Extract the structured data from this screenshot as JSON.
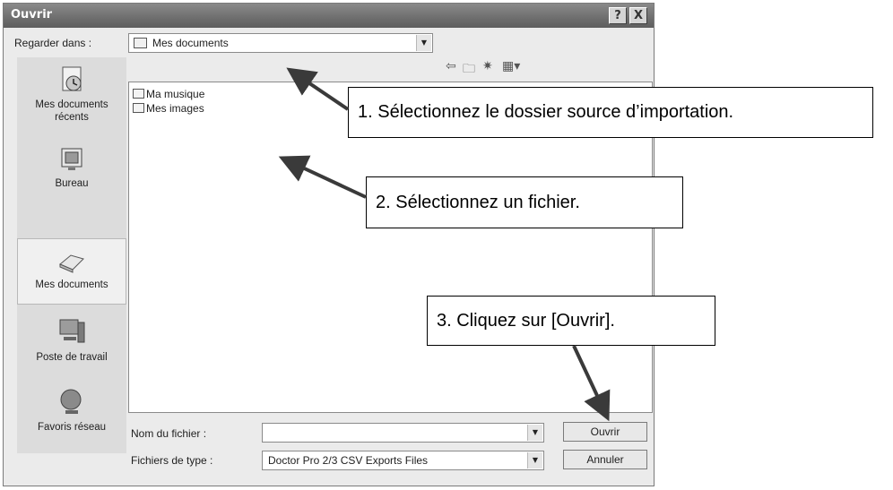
{
  "dialog": {
    "title": "Ouvrir",
    "help_label": "?",
    "close_label": "X",
    "look_in_label": "Regarder dans :",
    "look_in_value": "Mes documents",
    "places": [
      {
        "label": "Mes documents récents",
        "icon": "recent-documents-icon"
      },
      {
        "label": "Bureau",
        "icon": "desktop-icon"
      },
      {
        "label": "Mes documents",
        "icon": "my-documents-icon",
        "selected": true
      },
      {
        "label": "Poste de travail",
        "icon": "computer-icon"
      },
      {
        "label": "Favoris réseau",
        "icon": "network-icon"
      }
    ],
    "files": [
      "Ma musique",
      "Mes images"
    ],
    "filename_label": "Nom du fichier :",
    "filename_value": "",
    "filetype_label": "Fichiers de type :",
    "filetype_value": "Doctor Pro 2/3 CSV Exports Files",
    "open_button": "Ouvrir",
    "cancel_button": "Annuler"
  },
  "callouts": [
    "1. Sélectionnez le dossier source d’importation.",
    "2. Sélectionnez un fichier.",
    "3. Cliquez sur [Ouvrir]."
  ]
}
